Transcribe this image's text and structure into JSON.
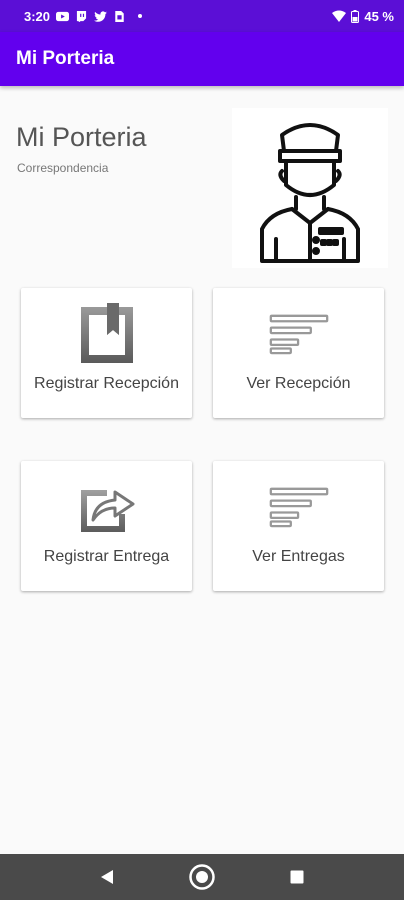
{
  "status_bar": {
    "time": "3:20",
    "battery": "45 %"
  },
  "app_bar": {
    "title": "Mi Porteria"
  },
  "hero": {
    "title": "Mi Porteria",
    "subtitle": "Correspondencia",
    "image": "doorman-illustration"
  },
  "cards": [
    {
      "label": "Registrar Recepción",
      "icon": "bookmark-box-icon"
    },
    {
      "label": "Ver Recepción",
      "icon": "list-lines-icon"
    },
    {
      "label": "Registrar Entrega",
      "icon": "share-out-icon"
    },
    {
      "label": "Ver Entregas",
      "icon": "list-lines-icon"
    }
  ],
  "colors": {
    "status_bar": "#5b0fd6",
    "app_bar": "#6200ee",
    "background": "#fafafa",
    "nav_bar": "#4a4a4a"
  }
}
